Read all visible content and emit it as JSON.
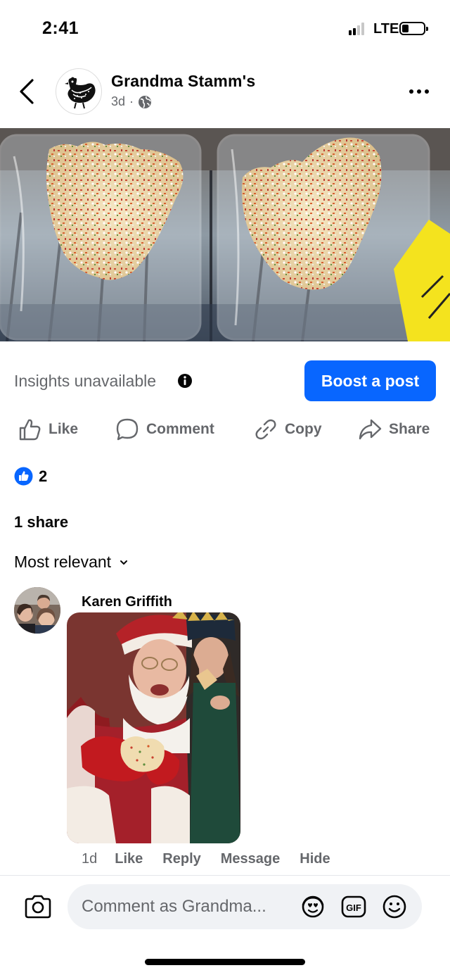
{
  "status_bar": {
    "time": "2:41",
    "network": "LTE",
    "battery_level": 0.25
  },
  "post": {
    "page_name": "Grandma Stamm's",
    "time_ago": "3d",
    "separator": "·",
    "audience_icon": "globe-icon",
    "image_alt": "Frosted sugar cookies with sprinkles in clear plastic clamshell containers"
  },
  "insights": {
    "label": "Insights unavailable",
    "boost_label": "Boost a post"
  },
  "actions": {
    "like": "Like",
    "comment": "Comment",
    "copy": "Copy",
    "share": "Share"
  },
  "reactions": {
    "count": "2",
    "shares": "1 share"
  },
  "sort": {
    "label": "Most relevant"
  },
  "comment": {
    "author": "Karen Griffith",
    "time": "1d",
    "like": "Like",
    "reply": "Reply",
    "message": "Message",
    "hide": "Hide"
  },
  "composer": {
    "placeholder": "Comment as Grandma..."
  },
  "colors": {
    "accent": "#0866ff",
    "secondary_text": "#65676b",
    "input_bg": "#f0f2f5"
  }
}
